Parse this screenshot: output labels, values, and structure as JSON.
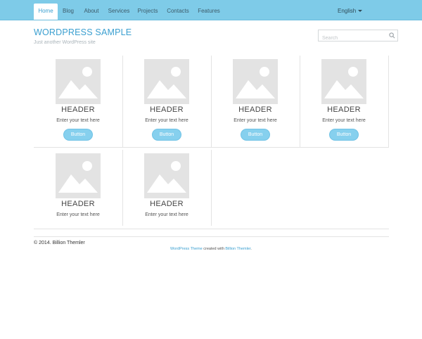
{
  "nav": {
    "items": [
      {
        "label": "Home",
        "active": true
      },
      {
        "label": "Blog"
      },
      {
        "label": "About"
      },
      {
        "label": "Services"
      },
      {
        "label": "Projects"
      },
      {
        "label": "Contacts"
      },
      {
        "label": "Features"
      }
    ],
    "language": "English"
  },
  "site": {
    "title": "WORDPRESS SAMPLE",
    "tagline": "Just another WordPress site"
  },
  "search": {
    "placeholder": "Search",
    "value": "",
    "icon": "search-icon"
  },
  "cells": [
    {
      "image_icon": "image-placeholder-icon",
      "header": "HEADER",
      "text": "Enter your text here",
      "button": "Button"
    },
    {
      "image_icon": "image-placeholder-icon",
      "header": "HEADER",
      "text": "Enter your text here",
      "button": "Button"
    },
    {
      "image_icon": "image-placeholder-icon",
      "header": "HEADER",
      "text": "Enter your text here",
      "button": "Button"
    },
    {
      "image_icon": "image-placeholder-icon",
      "header": "HEADER",
      "text": "Enter your text here",
      "button": "Button"
    },
    {
      "image_icon": "image-placeholder-icon",
      "header": "HEADER",
      "text": "Enter your text here"
    },
    {
      "image_icon": "image-placeholder-icon",
      "header": "HEADER",
      "text": "Enter your text here"
    }
  ],
  "footer": {
    "copyright": "© 2014. Billion Themler",
    "credit": {
      "theme_link": "WordPress Theme",
      "middle": " created with ",
      "author_link": "Billion Themler",
      "end": "."
    }
  },
  "colors": {
    "nav_bg": "#7ecbe8",
    "accent": "#3a9fd0",
    "button_bg": "#86d0ee",
    "placeholder_bg": "#e3e3e3"
  }
}
